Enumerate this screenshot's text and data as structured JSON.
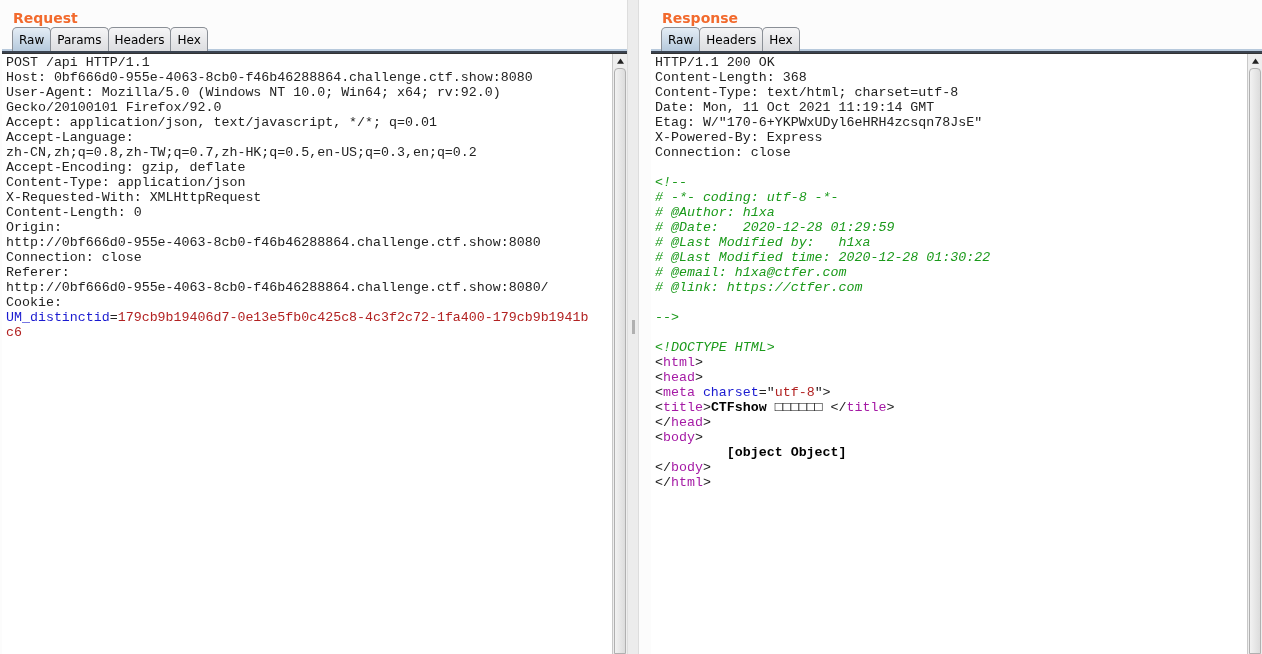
{
  "panels": [
    {
      "title": "Request",
      "tabs": [
        {
          "label": "Raw",
          "selected": true
        },
        {
          "label": "Params",
          "selected": false
        },
        {
          "label": "Headers",
          "selected": false
        },
        {
          "label": "Hex",
          "selected": false
        }
      ],
      "lines": [
        {
          "segments": [
            {
              "kind": "plain",
              "text": "POST /api HTTP/1.1"
            }
          ]
        },
        {
          "segments": [
            {
              "kind": "plain",
              "text": "Host: 0bf666d0-955e-4063-8cb0-f46b46288864.challenge.ctf.show:8080"
            }
          ]
        },
        {
          "segments": [
            {
              "kind": "plain",
              "text": "User-Agent: Mozilla/5.0 (Windows NT 10.0; Win64; x64; rv:92.0)"
            }
          ]
        },
        {
          "segments": [
            {
              "kind": "plain",
              "text": "Gecko/20100101 Firefox/92.0"
            }
          ]
        },
        {
          "segments": [
            {
              "kind": "plain",
              "text": "Accept: application/json, text/javascript, */*; q=0.01"
            }
          ]
        },
        {
          "segments": [
            {
              "kind": "plain",
              "text": "Accept-Language:"
            }
          ]
        },
        {
          "segments": [
            {
              "kind": "plain",
              "text": "zh-CN,zh;q=0.8,zh-TW;q=0.7,zh-HK;q=0.5,en-US;q=0.3,en;q=0.2"
            }
          ]
        },
        {
          "segments": [
            {
              "kind": "plain",
              "text": "Accept-Encoding: gzip, deflate"
            }
          ]
        },
        {
          "segments": [
            {
              "kind": "plain",
              "text": "Content-Type: application/json"
            }
          ]
        },
        {
          "segments": [
            {
              "kind": "plain",
              "text": "X-Requested-With: XMLHttpRequest"
            }
          ]
        },
        {
          "segments": [
            {
              "kind": "plain",
              "text": "Content-Length: 0"
            }
          ]
        },
        {
          "segments": [
            {
              "kind": "plain",
              "text": "Origin:"
            }
          ]
        },
        {
          "segments": [
            {
              "kind": "plain",
              "text": "http://0bf666d0-955e-4063-8cb0-f46b46288864.challenge.ctf.show:8080"
            }
          ]
        },
        {
          "segments": [
            {
              "kind": "plain",
              "text": "Connection: close"
            }
          ]
        },
        {
          "segments": [
            {
              "kind": "plain",
              "text": "Referer:"
            }
          ]
        },
        {
          "segments": [
            {
              "kind": "plain",
              "text": "http://0bf666d0-955e-4063-8cb0-f46b46288864.challenge.ctf.show:8080/"
            }
          ]
        },
        {
          "segments": [
            {
              "kind": "plain",
              "text": "Cookie:"
            }
          ]
        },
        {
          "segments": [
            {
              "kind": "name",
              "text": "UM_distinctid"
            },
            {
              "kind": "plain",
              "text": "="
            },
            {
              "kind": "value",
              "text": "179cb9b19406d7-0e13e5fb0c425c8-4c3f2c72-1fa400-179cb9b1941b"
            }
          ]
        },
        {
          "segments": [
            {
              "kind": "value",
              "text": "c6"
            }
          ]
        }
      ]
    },
    {
      "title": "Response",
      "tabs": [
        {
          "label": "Raw",
          "selected": true
        },
        {
          "label": "Headers",
          "selected": false
        },
        {
          "label": "Hex",
          "selected": false
        }
      ],
      "lines": [
        {
          "segments": [
            {
              "kind": "plain",
              "text": "HTTP/1.1 200 OK"
            }
          ]
        },
        {
          "segments": [
            {
              "kind": "plain",
              "text": "Content-Length: 368"
            }
          ]
        },
        {
          "segments": [
            {
              "kind": "plain",
              "text": "Content-Type: text/html; charset=utf-8"
            }
          ]
        },
        {
          "segments": [
            {
              "kind": "plain",
              "text": "Date: Mon, 11 Oct 2021 11:19:14 GMT"
            }
          ]
        },
        {
          "segments": [
            {
              "kind": "plain",
              "text": "Etag: W/\"170-6+YKPWxUDyl6eHRH4zcsqn78JsE\""
            }
          ]
        },
        {
          "segments": [
            {
              "kind": "plain",
              "text": "X-Powered-By: Express"
            }
          ]
        },
        {
          "segments": [
            {
              "kind": "plain",
              "text": "Connection: close"
            }
          ],
          "space_after": true
        },
        {
          "segments": [
            {
              "kind": "comment",
              "text": "<!--"
            }
          ]
        },
        {
          "segments": [
            {
              "kind": "comment",
              "text": "# -*- coding: utf-8 -*-"
            }
          ]
        },
        {
          "segments": [
            {
              "kind": "comment",
              "text": "# @Author: h1xa"
            }
          ]
        },
        {
          "segments": [
            {
              "kind": "comment",
              "text": "# @Date:   2020-12-28 01:29:59"
            }
          ]
        },
        {
          "segments": [
            {
              "kind": "comment",
              "text": "# @Last Modified by:   h1xa"
            }
          ]
        },
        {
          "segments": [
            {
              "kind": "comment",
              "text": "# @Last Modified time: 2020-12-28 01:30:22"
            }
          ]
        },
        {
          "segments": [
            {
              "kind": "comment",
              "text": "# @email: h1xa@ctfer.com"
            }
          ]
        },
        {
          "segments": [
            {
              "kind": "comment",
              "text": "# @link: https://ctfer.com"
            }
          ],
          "space_after": true
        },
        {
          "segments": [
            {
              "kind": "comment",
              "text": "-->"
            }
          ],
          "space_after": true
        },
        {
          "segments": [
            {
              "kind": "comment",
              "text": "<!DOCTYPE HTML>"
            }
          ]
        },
        {
          "segments": [
            {
              "kind": "plain",
              "text": "<"
            },
            {
              "kind": "tag",
              "text": "html"
            },
            {
              "kind": "plain",
              "text": ">"
            }
          ]
        },
        {
          "segments": [
            {
              "kind": "plain",
              "text": "<"
            },
            {
              "kind": "tag",
              "text": "head"
            },
            {
              "kind": "plain",
              "text": ">"
            }
          ]
        },
        {
          "segments": [
            {
              "kind": "plain",
              "text": "<"
            },
            {
              "kind": "tag",
              "text": "meta"
            },
            {
              "kind": "name",
              "text": " charset"
            },
            {
              "kind": "plain",
              "text": "=\""
            },
            {
              "kind": "value",
              "text": "utf-8"
            },
            {
              "kind": "plain",
              "text": "\">"
            }
          ]
        },
        {
          "segments": [
            {
              "kind": "plain",
              "text": "<"
            },
            {
              "kind": "tag",
              "text": "title"
            },
            {
              "kind": "plain",
              "text": ">"
            },
            {
              "kind": "bold",
              "text": "CTFshow □□□□□□ "
            },
            {
              "kind": "plain",
              "text": "</"
            },
            {
              "kind": "tag",
              "text": "title"
            },
            {
              "kind": "plain",
              "text": ">"
            }
          ]
        },
        {
          "segments": [
            {
              "kind": "plain",
              "text": "</"
            },
            {
              "kind": "tag",
              "text": "head"
            },
            {
              "kind": "plain",
              "text": ">"
            }
          ]
        },
        {
          "segments": [
            {
              "kind": "plain",
              "text": "<"
            },
            {
              "kind": "tag",
              "text": "body"
            },
            {
              "kind": "plain",
              "text": ">"
            }
          ]
        },
        {
          "segments": [
            {
              "kind": "bold",
              "text": "         [object Object]"
            }
          ]
        },
        {
          "segments": [
            {
              "kind": "plain",
              "text": "</"
            },
            {
              "kind": "tag",
              "text": "body"
            },
            {
              "kind": "plain",
              "text": ">"
            }
          ]
        },
        {
          "segments": [
            {
              "kind": "plain",
              "text": "</"
            },
            {
              "kind": "tag",
              "text": "html"
            },
            {
              "kind": "plain",
              "text": ">"
            }
          ]
        }
      ]
    }
  ]
}
